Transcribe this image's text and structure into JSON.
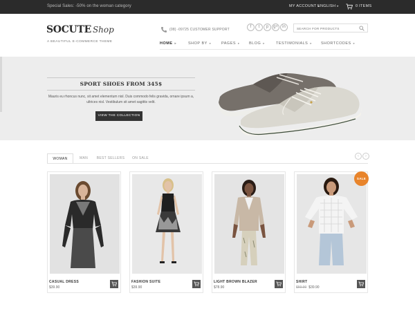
{
  "topbar": {
    "promo": "Special Sales: -50% on the woman category",
    "my_account": "MY ACCOUNT",
    "language": "ENGLISH",
    "cart_label": "0 ITEMS"
  },
  "header": {
    "logo_main": "SOCUTE",
    "logo_script": "Shop",
    "tagline": "A BEAUTIFUL E-COMMERCE THEME",
    "support": "(08) -09725 CUSTOMER SUPPORT",
    "socials": [
      {
        "icon": "facebook-icon",
        "glyph": "f"
      },
      {
        "icon": "twitter-icon",
        "glyph": "t"
      },
      {
        "icon": "pinterest-icon",
        "glyph": "p"
      },
      {
        "icon": "google-plus-icon",
        "glyph": "g+"
      },
      {
        "icon": "linkedin-icon",
        "glyph": "in"
      }
    ],
    "search_placeholder": "SEARCH FOR PRODUCTS"
  },
  "nav": {
    "items": [
      {
        "label": "HOME",
        "active": true
      },
      {
        "label": "SHOP BY",
        "active": false
      },
      {
        "label": "PAGES",
        "active": false
      },
      {
        "label": "BLOG",
        "active": false
      },
      {
        "label": "TESTIMONIALS",
        "active": false
      },
      {
        "label": "SHORTCODES",
        "active": false
      }
    ]
  },
  "hero": {
    "title": "SPORT SHOES FROM 345$",
    "description": "Mauris eu rhoncus nunc, sit amet elementum nisl. Duis commodo felis gravida, ornare ipsum a, ultrices nisl. Vestibulum sit amet sagittis velit.",
    "button": "VIEW THE COLLECTION"
  },
  "tabs": [
    "WOMAN",
    "MAN",
    "BEST SELLERS",
    "ON SALE"
  ],
  "products": [
    {
      "name": "CASUAL DRESS",
      "price": "$39.90",
      "old_price": ""
    },
    {
      "name": "FASHION SUITE",
      "price": "$39.90",
      "old_price": ""
    },
    {
      "name": "LIGHT BROWN BLAZER",
      "price": "$78.90",
      "old_price": ""
    },
    {
      "name": "SHIRT",
      "price": "$39.90",
      "old_price": "$59.90"
    }
  ],
  "sale_badge": "SALE",
  "colors": {
    "topbar": "#2b2b2b",
    "hero_bg": "#ededed",
    "sale": "#e8842b",
    "button": "#333333"
  }
}
